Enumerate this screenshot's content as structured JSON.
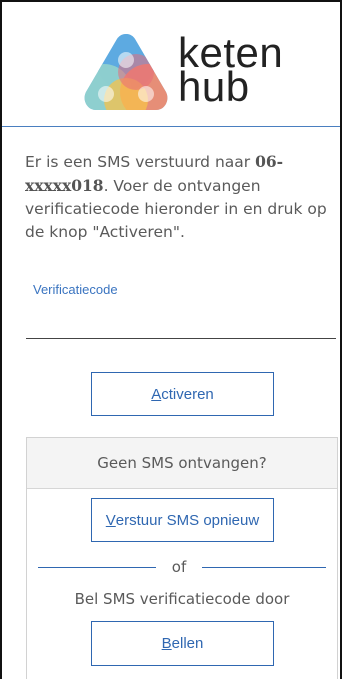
{
  "logo": {
    "word_line1": "keten",
    "word_line2": "hub",
    "colors": [
      "#5ab0e3",
      "#f05f55",
      "#9ccb6a",
      "#f7c24a",
      "#7c8fc4"
    ]
  },
  "message": {
    "prefix": "Er is een SMS verstuurd naar ",
    "phone": "06-xxxxx018",
    "suffix": ". Voer de ontvangen verificatiecode hieronder in en druk op de knop \"Activeren\"."
  },
  "code_field": {
    "label": "Verificatiecode",
    "value": "",
    "placeholder": ""
  },
  "activate_button": {
    "accesskey": "A",
    "rest": "ctiveren"
  },
  "no_sms_panel": {
    "title": "Geen SMS ontvangen?",
    "resend_button": {
      "accesskey": "V",
      "rest": "erstuur SMS opnieuw"
    },
    "separator": "of",
    "call_text": "Bel SMS verificatiecode door",
    "call_button": {
      "accesskey": "B",
      "rest": "ellen"
    }
  }
}
